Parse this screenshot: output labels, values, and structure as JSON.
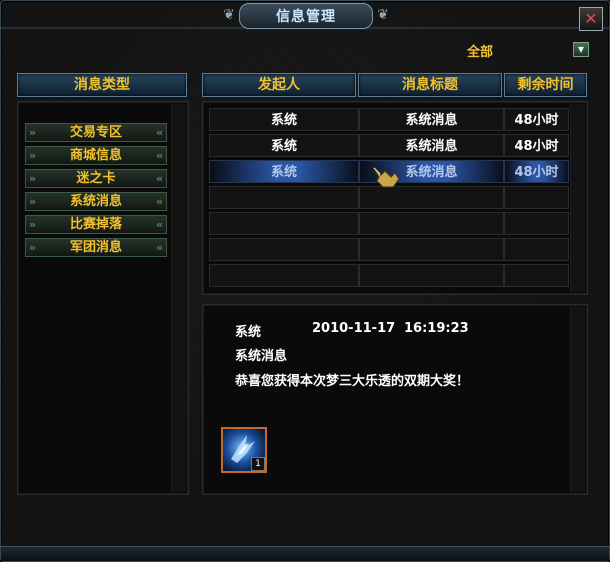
{
  "window": {
    "title": "信息管理",
    "close_label": "✕"
  },
  "filter": {
    "label": "全部",
    "arrow_icon": "triangle-down-icon"
  },
  "category_panel": {
    "header": "消息类型",
    "items": [
      "交易专区",
      "商城信息",
      "迷之卡",
      "系统消息",
      "比赛掉落",
      "军团消息"
    ]
  },
  "message_table": {
    "columns": [
      "发起人",
      "消息标题",
      "剩余时间"
    ],
    "rows": [
      {
        "sender": "系统",
        "title": "系统消息",
        "time": "48小时"
      },
      {
        "sender": "系统",
        "title": "系统消息",
        "time": "48小时"
      },
      {
        "sender": "系统",
        "title": "系统消息",
        "time": "48小时"
      }
    ],
    "selected_row": 2,
    "empty_rows": 4
  },
  "detail": {
    "sender": "系统",
    "date": "2010-11-17",
    "time": "16:19:23",
    "title": "系统消息",
    "body": "恭喜您获得本次梦三大乐透的双期大奖！",
    "attachment": {
      "icon": "blue-crystal-icon",
      "count": "1"
    }
  },
  "colors": {
    "gold_text": "#f2c12e",
    "header_blue": "#27435b",
    "selected_blue": "#2a56a8",
    "attachment_border": "#c56a2a"
  }
}
